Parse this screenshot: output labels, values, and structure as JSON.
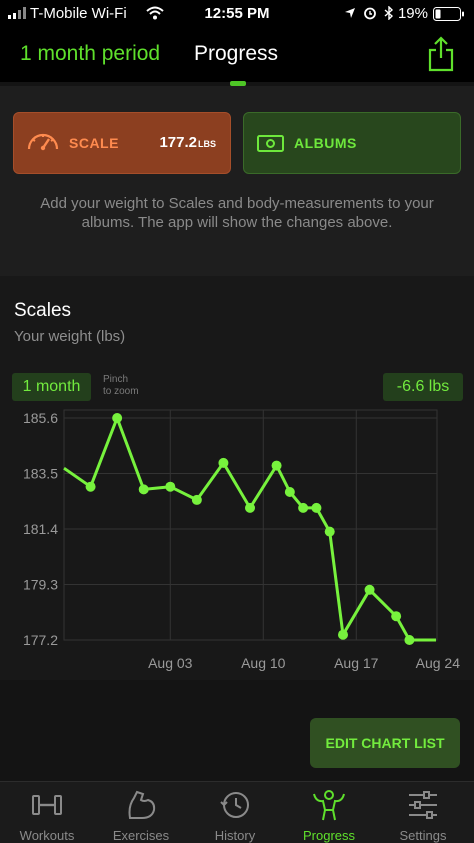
{
  "status_bar": {
    "carrier": "T-Mobile Wi-Fi",
    "time": "12:55 PM",
    "battery": "19%"
  },
  "header": {
    "period_label": "1 month period",
    "title": "Progress",
    "share_icon": "share-icon"
  },
  "summary": {
    "scale_label": "SCALE",
    "scale_value": "177.2",
    "scale_unit": "LBS",
    "albums_label": "ALBUMS",
    "hint": "Add your weight to Scales and body-measurements to your albums. The app will show the changes above."
  },
  "scales": {
    "title": "Scales",
    "subtitle": "Your weight (lbs)",
    "period_pill": "1 month",
    "pinch_hint_line1": "Pinch",
    "pinch_hint_line2": "to zoom",
    "delta": "-6.6 lbs"
  },
  "chart_data": {
    "type": "line",
    "x_tick_labels": [
      "Aug 03",
      "Aug 10",
      "Aug 17",
      "Aug 24"
    ],
    "y_tick_labels": [
      "185.6",
      "183.5",
      "181.4",
      "179.3",
      "177.2"
    ],
    "ylim": [
      177.2,
      185.6
    ],
    "series": [
      {
        "points": [
          {
            "x": "2018-07-26",
            "y": 183.7
          },
          {
            "x": "2018-07-28",
            "y": 183.0
          },
          {
            "x": "2018-07-30",
            "y": 185.6
          },
          {
            "x": "2018-08-01",
            "y": 182.9
          },
          {
            "x": "2018-08-03",
            "y": 183.0
          },
          {
            "x": "2018-08-05",
            "y": 182.5
          },
          {
            "x": "2018-08-07",
            "y": 183.9
          },
          {
            "x": "2018-08-09",
            "y": 182.2
          },
          {
            "x": "2018-08-11",
            "y": 183.8
          },
          {
            "x": "2018-08-12",
            "y": 182.8
          },
          {
            "x": "2018-08-13",
            "y": 182.2
          },
          {
            "x": "2018-08-14",
            "y": 182.2
          },
          {
            "x": "2018-08-15",
            "y": 181.3
          },
          {
            "x": "2018-08-16",
            "y": 177.4
          },
          {
            "x": "2018-08-18",
            "y": 179.1
          },
          {
            "x": "2018-08-20",
            "y": 178.1
          },
          {
            "x": "2018-08-21",
            "y": 177.2
          },
          {
            "x": "2018-08-23",
            "y": 177.2
          }
        ]
      }
    ],
    "line_color": "#77f23d",
    "grid": true
  },
  "actions": {
    "edit_chart_list": "EDIT CHART LIST"
  },
  "tabs": [
    {
      "label": "Workouts",
      "icon": "dumbbell-icon"
    },
    {
      "label": "Exercises",
      "icon": "flexed-arm-icon"
    },
    {
      "label": "History",
      "icon": "history-clock-icon"
    },
    {
      "label": "Progress",
      "icon": "bodybuilder-icon",
      "active": true
    },
    {
      "label": "Settings",
      "icon": "sliders-icon"
    }
  ]
}
